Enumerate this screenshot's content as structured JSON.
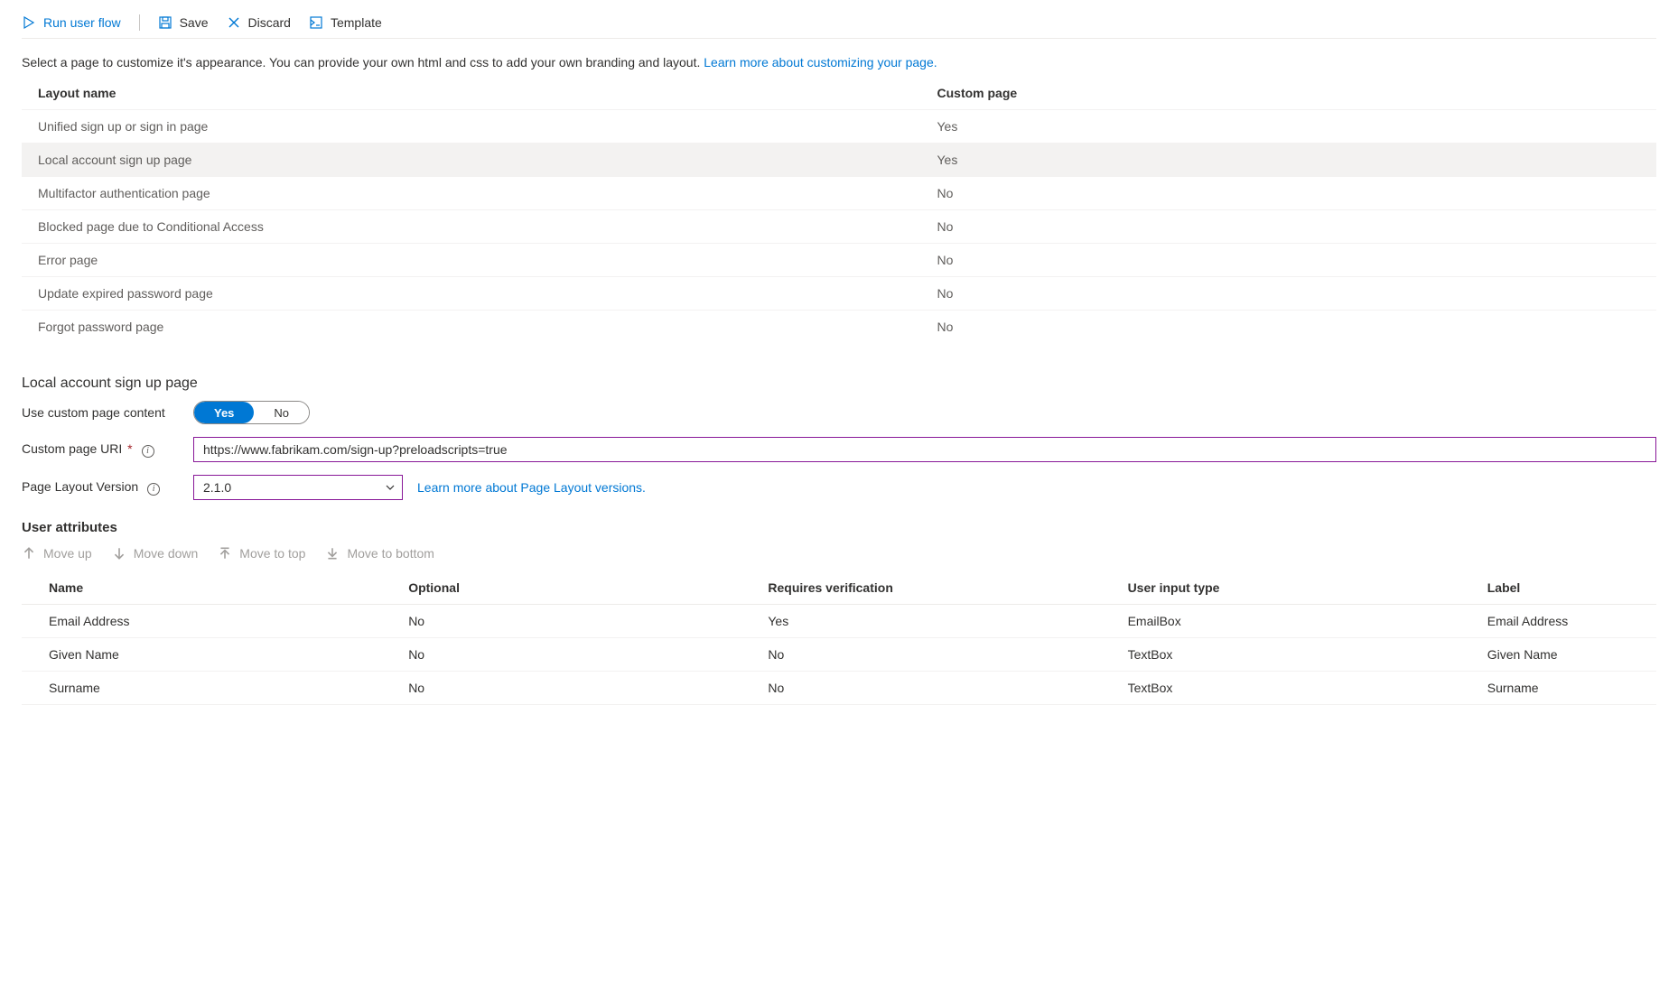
{
  "toolbar": {
    "run": "Run user flow",
    "save": "Save",
    "discard": "Discard",
    "template": "Template"
  },
  "intro": {
    "text": "Select a page to customize it's appearance. You can provide your own html and css to add your own branding and layout. ",
    "link": "Learn more about customizing your page."
  },
  "layoutsHeader": {
    "name": "Layout name",
    "custom": "Custom page"
  },
  "layouts": [
    {
      "name": "Unified sign up or sign in page",
      "custom": "Yes",
      "selected": false
    },
    {
      "name": "Local account sign up page",
      "custom": "Yes",
      "selected": true
    },
    {
      "name": "Multifactor authentication page",
      "custom": "No",
      "selected": false
    },
    {
      "name": "Blocked page due to Conditional Access",
      "custom": "No",
      "selected": false
    },
    {
      "name": "Error page",
      "custom": "No",
      "selected": false
    },
    {
      "name": "Update expired password page",
      "custom": "No",
      "selected": false
    },
    {
      "name": "Forgot password page",
      "custom": "No",
      "selected": false
    }
  ],
  "detail": {
    "heading": "Local account sign up page",
    "useCustomLabel": "Use custom page content",
    "toggle": {
      "yes": "Yes",
      "no": "No"
    },
    "uriLabel": "Custom page URI",
    "uriValue": "https://www.fabrikam.com/sign-up?preloadscripts=true",
    "versionLabel": "Page Layout Version",
    "versionValue": "2.1.0",
    "versionLink": "Learn more about Page Layout versions."
  },
  "attrs": {
    "heading": "User attributes",
    "toolbar": {
      "up": "Move up",
      "down": "Move down",
      "top": "Move to top",
      "bottom": "Move to bottom"
    },
    "header": {
      "name": "Name",
      "optional": "Optional",
      "requires": "Requires verification",
      "type": "User input type",
      "label": "Label"
    },
    "rows": [
      {
        "name": "Email Address",
        "optional": "No",
        "requires": "Yes",
        "type": "EmailBox",
        "label": "Email Address"
      },
      {
        "name": "Given Name",
        "optional": "No",
        "requires": "No",
        "type": "TextBox",
        "label": "Given Name"
      },
      {
        "name": "Surname",
        "optional": "No",
        "requires": "No",
        "type": "TextBox",
        "label": "Surname"
      }
    ]
  }
}
